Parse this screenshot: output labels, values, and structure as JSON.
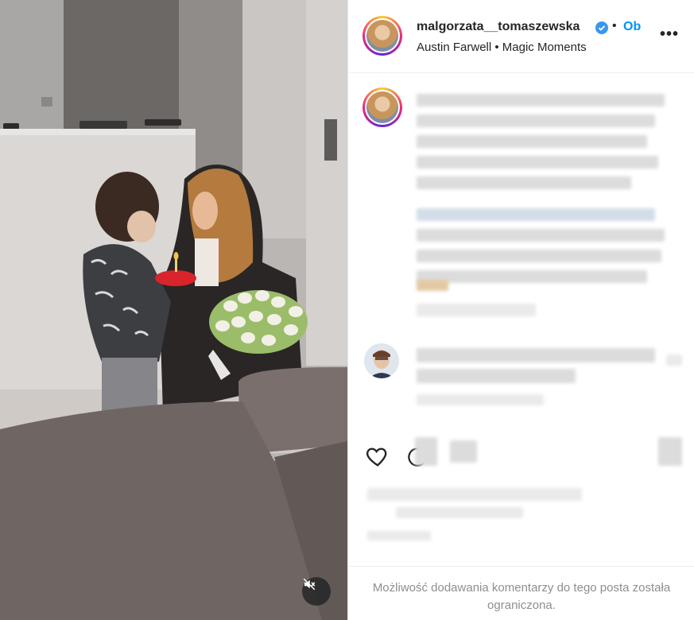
{
  "post": {
    "username": "malgorzata__tomaszewska",
    "follow_label": "Ob",
    "audio_label": "Austin Farwell • Magic Moments",
    "more_label": "•••",
    "separator": "•"
  },
  "footer": {
    "comments_restricted": "Możliwość dodawania komentarzy do tego posta została ograniczona."
  },
  "icons": {
    "verified": "verified-badge-icon",
    "heart": "heart-icon",
    "comment": "comment-icon",
    "mute": "speaker-muted-icon",
    "more": "more-options-icon"
  },
  "colors": {
    "accent": "#0095f6",
    "verified": "#3897f0",
    "muted_text": "#8e8e8e",
    "text": "#262626"
  }
}
